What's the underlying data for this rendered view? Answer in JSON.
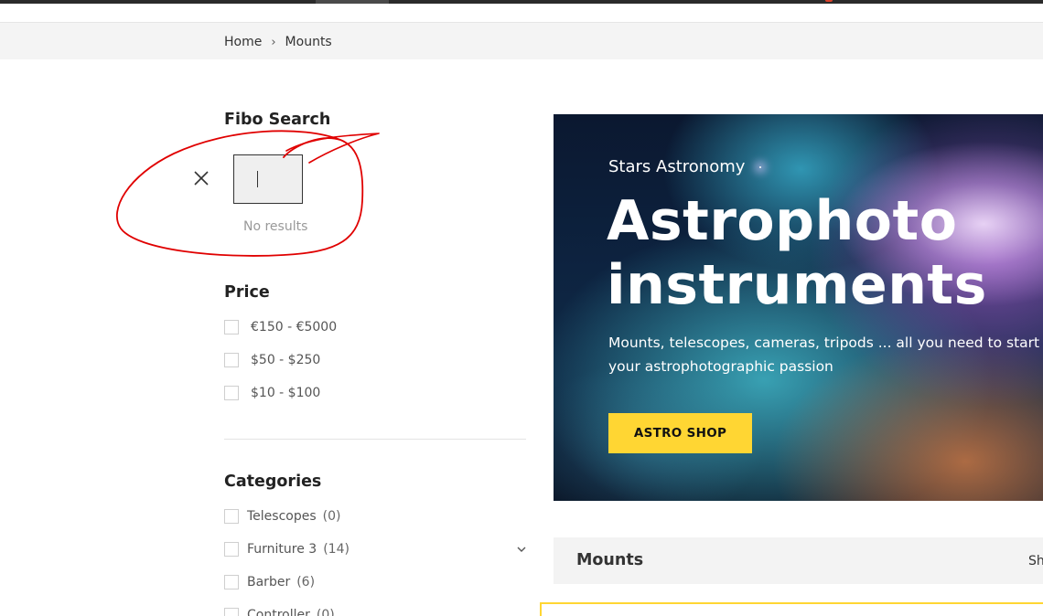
{
  "breadcrumb": {
    "home": "Home",
    "separator": "›",
    "current": "Mounts"
  },
  "search_widget": {
    "title": "Fibo Search",
    "close_icon": "close-icon",
    "no_results": "No results"
  },
  "price_filter": {
    "title": "Price",
    "options": [
      {
        "label": "€150 - €5000",
        "checked": false
      },
      {
        "label": "$50 - $250",
        "checked": false
      },
      {
        "label": "$10 - $100",
        "checked": false
      }
    ]
  },
  "categories": {
    "title": "Categories",
    "items": [
      {
        "label": "Telescopes",
        "count": "(0)"
      },
      {
        "label": "Furniture 3",
        "count": "(14)",
        "expandable": true
      },
      {
        "label": "Barber",
        "count": "(6)"
      },
      {
        "label": "Controller",
        "count": "(0)"
      }
    ]
  },
  "hero": {
    "eyebrow": "Stars Astronomy",
    "title": "Astrophoto instruments",
    "description": "Mounts, telescopes, cameras, tripods ... all you need to start with your astrophotographic passion",
    "button": "ASTRO SHOP",
    "button_color": "#ffd633"
  },
  "listing_header": {
    "title": "Mounts",
    "right_text": "Sh"
  },
  "colors": {
    "annotation": "#e00000",
    "accent": "#ffd633"
  }
}
